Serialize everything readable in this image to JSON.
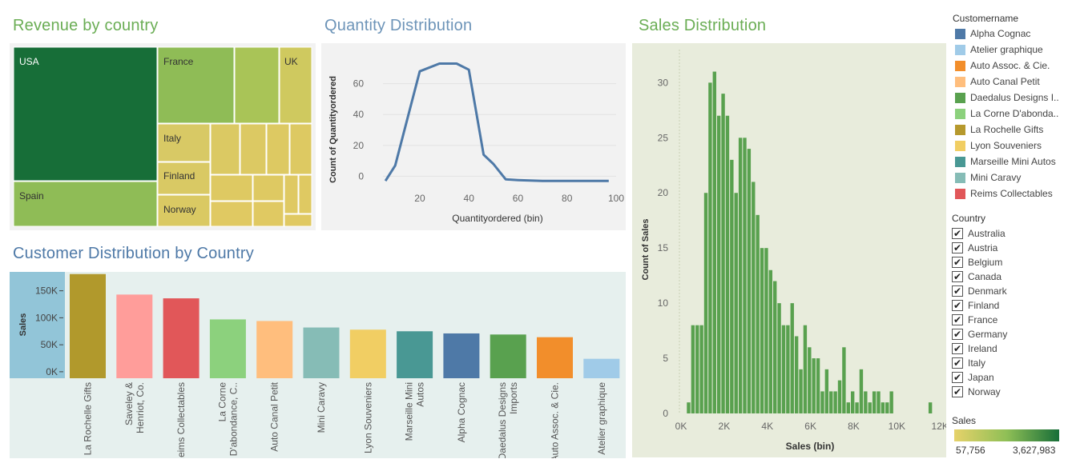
{
  "titles": {
    "revenue": "Revenue by country",
    "quantity": "Quantity Distribution",
    "sales": "Sales Distribution",
    "customer": "Customer Distribution by Country"
  },
  "colors": {
    "treemap_dark": "#176e38",
    "treemap_mid": "#8fbc56",
    "treemap_light": "#d2c95e",
    "line": "#4e79a7",
    "hist_bar": "#59a14f",
    "plot_bg_gray": "#f2f2f2",
    "plot_bg_green": "#e8ecdc",
    "plot_bg_teal": "#e6f0ee",
    "sidebar_blue": "#92c5d8"
  },
  "treemap": {
    "labels": [
      "USA",
      "France",
      "UK",
      "Spain",
      "Italy",
      "Finland",
      "Norway"
    ]
  },
  "chart_data": [
    {
      "type": "line",
      "title": "Quantity Distribution",
      "xlabel": "Quantityordered (bin)",
      "ylabel": "Count of Quantityordered",
      "x": [
        6,
        10,
        20,
        28,
        30,
        35,
        40,
        46,
        50,
        55,
        60,
        65,
        70,
        80,
        90,
        97
      ],
      "values": [
        -3,
        7,
        68,
        73,
        73,
        73,
        69,
        14,
        8,
        -2,
        -2.5,
        -2.8,
        -3,
        -3,
        -3,
        -3
      ],
      "xticks": [
        "20",
        "40",
        "60",
        "80",
        "100"
      ],
      "yticks": [
        "0",
        "20",
        "40",
        "60"
      ],
      "xlim": [
        5,
        100
      ],
      "ylim": [
        -6,
        80
      ]
    },
    {
      "type": "bar",
      "title": "Sales Distribution",
      "xlabel": "Sales (bin)",
      "ylabel": "Count of Sales",
      "bin_width": 200,
      "x_start": 400,
      "values": [
        1,
        8,
        8,
        8,
        20,
        30,
        31,
        27,
        29,
        27,
        23,
        20,
        25,
        25,
        24,
        21,
        18,
        15,
        15,
        13,
        12,
        10,
        8,
        8,
        10,
        7,
        4,
        8,
        6,
        5,
        5,
        2,
        4,
        2,
        2,
        3,
        6,
        1,
        2,
        1,
        4,
        2,
        1,
        2,
        2,
        1,
        1,
        2,
        0,
        0,
        0,
        0,
        0,
        0,
        0,
        0,
        1
      ],
      "xticks": [
        "0K",
        "2K",
        "4K",
        "6K",
        "8K",
        "10K",
        "12K"
      ],
      "yticks": [
        "0",
        "5",
        "10",
        "15",
        "20",
        "25",
        "30"
      ],
      "xlim": [
        0,
        12400
      ],
      "ylim": [
        0,
        33
      ]
    },
    {
      "type": "bar",
      "title": "Customer Distribution by Country",
      "ylabel": "Sales",
      "categories": [
        "La Rochelle Gifts",
        "Saveley & Henriot, Co.",
        "Reims Collectables",
        "La Corne D'abondance, C..",
        "Auto Canal Petit",
        "Mini Caravy",
        "Lyon Souveniers",
        "Marseille Mini Autos",
        "Alpha Cognac",
        "Daedalus Designs Imports",
        "Auto Assoc. & Cie.",
        "Atelier graphique"
      ],
      "values": [
        181000,
        143000,
        136000,
        97000,
        94000,
        82000,
        78000,
        75000,
        71000,
        69000,
        64000,
        24000
      ],
      "colors": [
        "#b1992c",
        "#ff9d9a",
        "#e15759",
        "#8cd17d",
        "#ffbe7d",
        "#86bcb6",
        "#f1ce63",
        "#499894",
        "#4e79a7",
        "#59a14f",
        "#f28e2b",
        "#a0cbe8"
      ],
      "yticks": [
        "0K",
        "50K",
        "100K",
        "150K"
      ],
      "ylim": [
        -12000,
        185000
      ]
    }
  ],
  "legend": {
    "customer_title": "Customername",
    "customers": [
      {
        "name": "Alpha Cognac",
        "color": "#4e79a7"
      },
      {
        "name": "Atelier graphique",
        "color": "#a0cbe8"
      },
      {
        "name": "Auto Assoc. & Cie.",
        "color": "#f28e2b"
      },
      {
        "name": "Auto Canal Petit",
        "color": "#ffbe7d"
      },
      {
        "name": "Daedalus Designs I..",
        "color": "#59a14f"
      },
      {
        "name": "La Corne D'abonda..",
        "color": "#8cd17d"
      },
      {
        "name": "La Rochelle Gifts",
        "color": "#b6992d"
      },
      {
        "name": "Lyon Souveniers",
        "color": "#f1ce63"
      },
      {
        "name": "Marseille Mini Autos",
        "color": "#499894"
      },
      {
        "name": "Mini Caravy",
        "color": "#86bcb6"
      },
      {
        "name": "Reims Collectables",
        "color": "#e15759"
      }
    ],
    "country_title": "Country",
    "countries": [
      "Australia",
      "Austria",
      "Belgium",
      "Canada",
      "Denmark",
      "Finland",
      "France",
      "Germany",
      "Ireland",
      "Italy",
      "Japan",
      "Norway"
    ],
    "sales_title": "Sales",
    "sales_min": "57,756",
    "sales_max": "3,627,983"
  }
}
